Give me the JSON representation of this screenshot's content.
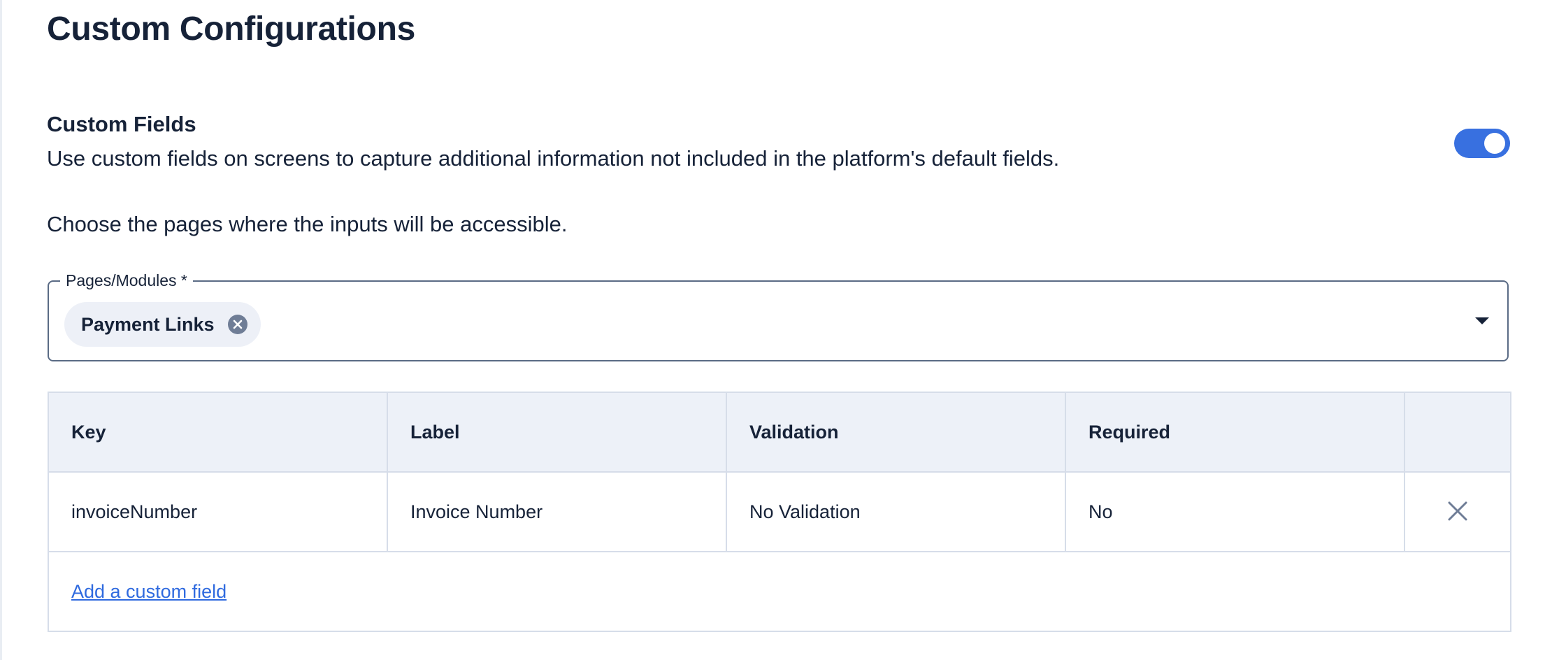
{
  "page": {
    "title": "Custom Configurations"
  },
  "custom_fields": {
    "title": "Custom Fields",
    "description": "Use custom fields on screens to capture additional information not included in the platform's default fields.",
    "toggle_enabled": true,
    "choose_pages_text": "Choose the pages where the inputs will be accessible."
  },
  "pages_select": {
    "label": "Pages/Modules *",
    "selected": [
      "Payment Links"
    ],
    "chip_remove_icon": "close-circle-icon",
    "dropdown_icon": "caret-down-icon"
  },
  "fields_table": {
    "columns": [
      "Key",
      "Label",
      "Validation",
      "Required",
      ""
    ],
    "rows": [
      {
        "key": "invoiceNumber",
        "label": "Invoice Number",
        "validation": "No Validation",
        "required": "No",
        "remove_icon": "close-icon"
      }
    ],
    "add_link": "Add a custom field"
  },
  "colors": {
    "primary": "#3870e0",
    "link": "#2f6adf",
    "text": "#162238",
    "header_bg": "#edf1f8",
    "chip_bg": "#edf0f7",
    "border": "#d6dde9"
  }
}
